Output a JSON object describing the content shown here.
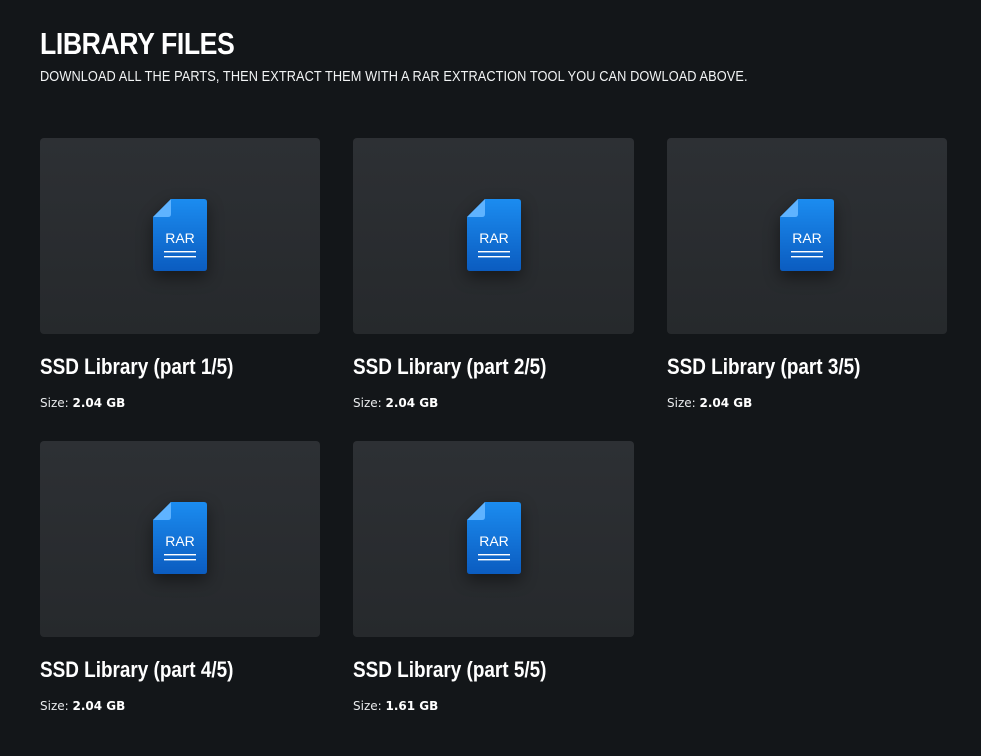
{
  "header": {
    "title": "LIBRARY FILES",
    "subtitle": "DOWNLOAD ALL THE PARTS, THEN EXTRACT THEM WITH A RAR EXTRACTION TOOL YOU CAN DOWLOAD ABOVE."
  },
  "files": [
    {
      "name": "SSD Library (part 1/5)",
      "size_label": "Size:",
      "size": "2.04 GB",
      "icon": "rar-file-icon",
      "icon_text": "RAR"
    },
    {
      "name": "SSD Library (part 2/5)",
      "size_label": "Size:",
      "size": "2.04 GB",
      "icon": "rar-file-icon",
      "icon_text": "RAR"
    },
    {
      "name": "SSD Library (part 3/5)",
      "size_label": "Size:",
      "size": "2.04 GB",
      "icon": "rar-file-icon",
      "icon_text": "RAR"
    },
    {
      "name": "SSD Library (part 4/5)",
      "size_label": "Size:",
      "size": "2.04 GB",
      "icon": "rar-file-icon",
      "icon_text": "RAR"
    },
    {
      "name": "SSD Library (part 5/5)",
      "size_label": "Size:",
      "size": "1.61 GB",
      "icon": "rar-file-icon",
      "icon_text": "RAR"
    }
  ],
  "colors": {
    "background": "#131619",
    "card": "#2b2e31",
    "icon_blue": "#1a7fe0",
    "icon_blue_dark": "#0d5db8",
    "text": "#ffffff"
  }
}
